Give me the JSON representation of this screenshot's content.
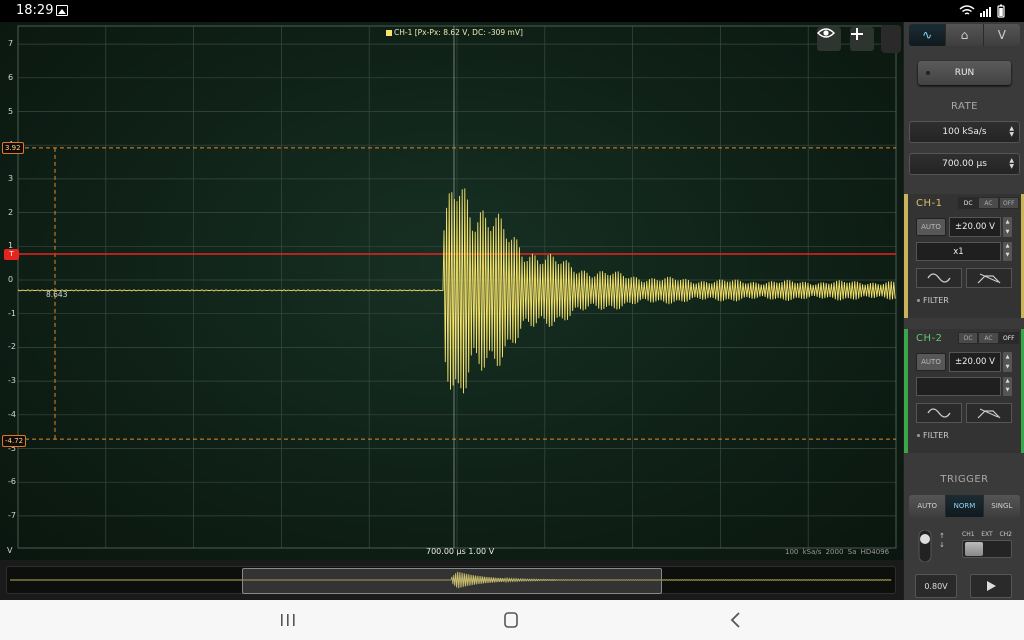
{
  "statusbar": {
    "time": "18:29"
  },
  "scope": {
    "legend": "CH-1 [Px-Px: 8.62 V, DC: -309 mV]",
    "y_axis_labels": [
      "7",
      "6",
      "5",
      "4",
      "3",
      "2",
      "1",
      "0",
      "-1",
      "-2",
      "-3",
      "-4",
      "-5",
      "-6",
      "-7"
    ],
    "unit_label": "V",
    "cursor_upper_label": "3.92",
    "cursor_lower_label": "-4.72",
    "trigger_marker_label": "T",
    "cursor_x_label": "8.643",
    "timebase_label": "700.00 µs  1.00 V",
    "acq_info": "100 kSa/s  2000 Sa  HD4096",
    "colors": {
      "trace": "#f6e36a",
      "trigger": "#e5241e",
      "cursor": "#e0882b"
    }
  },
  "panel": {
    "mode_tabs": [
      "∿",
      "⌂",
      "V"
    ],
    "run_label": "RUN",
    "rate_title": "RATE",
    "sample_rate": "100 kSa/s",
    "timebase": "700.00 µs",
    "ch1": {
      "title": "CH-1",
      "coupling": [
        "DC",
        "AC",
        "OFF"
      ],
      "auto": "AUTO",
      "volts": "±20.00 V",
      "probe": "x1",
      "filter": "FILTER"
    },
    "ch2": {
      "title": "CH-2",
      "coupling": [
        "DC",
        "AC",
        "OFF"
      ],
      "auto": "AUTO",
      "volts": "±20.00 V",
      "probe": "",
      "filter": "FILTER"
    },
    "trigger_title": "TRIGGER",
    "trigger_modes": [
      "AUTO",
      "NORM",
      "SINGL"
    ],
    "trigger_sources": [
      "CH1",
      "EXT",
      "CH2"
    ],
    "trigger_level": "0.80V"
  }
}
